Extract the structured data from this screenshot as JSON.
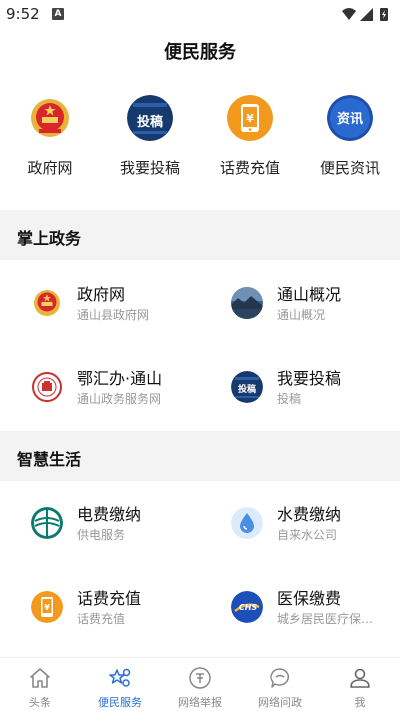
{
  "status": {
    "time": "9:52",
    "notif_letter": "A"
  },
  "page": {
    "title": "便民服务"
  },
  "quick": [
    {
      "label": "政府网",
      "icon": "national-emblem-icon"
    },
    {
      "label": "我要投稿",
      "icon": "submit-article-icon",
      "icon_text": "投稿"
    },
    {
      "label": "话费充值",
      "icon": "phone-recharge-icon"
    },
    {
      "label": "便民资讯",
      "icon": "news-info-icon",
      "icon_text": "资讯"
    }
  ],
  "sections": [
    {
      "title": "掌上政务",
      "items": [
        {
          "title": "政府网",
          "subtitle": "通山县政府网",
          "icon": "national-emblem-icon"
        },
        {
          "title": "通山概况",
          "subtitle": "通山概况",
          "icon": "landscape-photo-icon"
        },
        {
          "title": "鄂汇办·通山",
          "subtitle": "通山政务服务网",
          "icon": "ehuiban-seal-icon"
        },
        {
          "title": "我要投稿",
          "subtitle": "投稿",
          "icon": "submit-article-icon",
          "icon_text": "投稿"
        }
      ]
    },
    {
      "title": "智慧生活",
      "items": [
        {
          "title": "电费缴纳",
          "subtitle": "供电服务",
          "icon": "state-grid-icon"
        },
        {
          "title": "水费缴纳",
          "subtitle": "自来水公司",
          "icon": "water-drop-icon"
        },
        {
          "title": "话费充值",
          "subtitle": "话费充值",
          "icon": "phone-recharge-icon"
        },
        {
          "title": "医保缴费",
          "subtitle": "城乡居民医疗保…",
          "icon": "chs-medical-insurance-icon",
          "icon_text": "CHS"
        }
      ]
    }
  ],
  "nav": [
    {
      "label": "头条",
      "icon": "home-icon",
      "active": false
    },
    {
      "label": "便民服务",
      "icon": "services-star-icon",
      "active": true
    },
    {
      "label": "网络举报",
      "icon": "report-icon",
      "active": false
    },
    {
      "label": "网络问政",
      "icon": "chat-question-icon",
      "active": false
    },
    {
      "label": "我",
      "icon": "user-icon",
      "active": false
    }
  ],
  "colors": {
    "accent": "#2a6fd6",
    "emblem_red": "#d8262b",
    "recharge_orange": "#f39a1e",
    "news_blue": "#2a6ad0",
    "section_bg": "#f3f3f3"
  }
}
